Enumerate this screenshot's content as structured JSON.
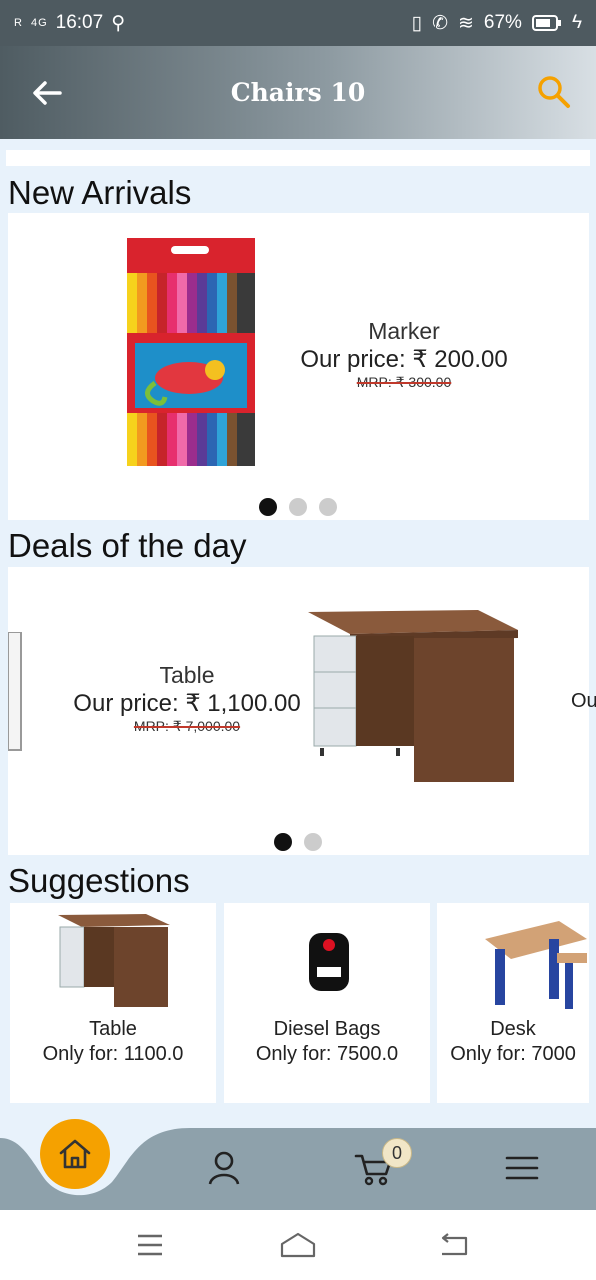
{
  "status_bar": {
    "signal_text": "R",
    "network": "4G",
    "time": "16:07",
    "battery": "67%"
  },
  "app_bar": {
    "title": "Chairs 10",
    "back_icon": "arrow-left-icon",
    "search_icon": "search-icon",
    "search_color": "#f5a100"
  },
  "new_arrivals": {
    "heading": "New Arrivals",
    "product": {
      "name": "Marker",
      "price": "Our price: ₹ 200.00",
      "mrp": "MRP: ₹ 300.00"
    },
    "carousel_pages": 3,
    "active_page": 1
  },
  "deals": {
    "heading": "Deals of the day",
    "product": {
      "name": "Table",
      "price": "Our price: ₹ 1,100.00",
      "mrp": "MRP: ₹ 7,000.00"
    },
    "next_peek": "Ou",
    "carousel_pages": 2,
    "active_page": 1
  },
  "suggestions": {
    "heading": "Suggestions",
    "items": [
      {
        "name": "Table",
        "price": "Only for: 1100.0"
      },
      {
        "name": "Diesel Bags",
        "price": "Only for: 7500.0"
      },
      {
        "name": "Desk",
        "price": "Only for: 7000"
      }
    ]
  },
  "bottom_nav": {
    "cart_count": "0",
    "home_color": "#f5a100"
  }
}
